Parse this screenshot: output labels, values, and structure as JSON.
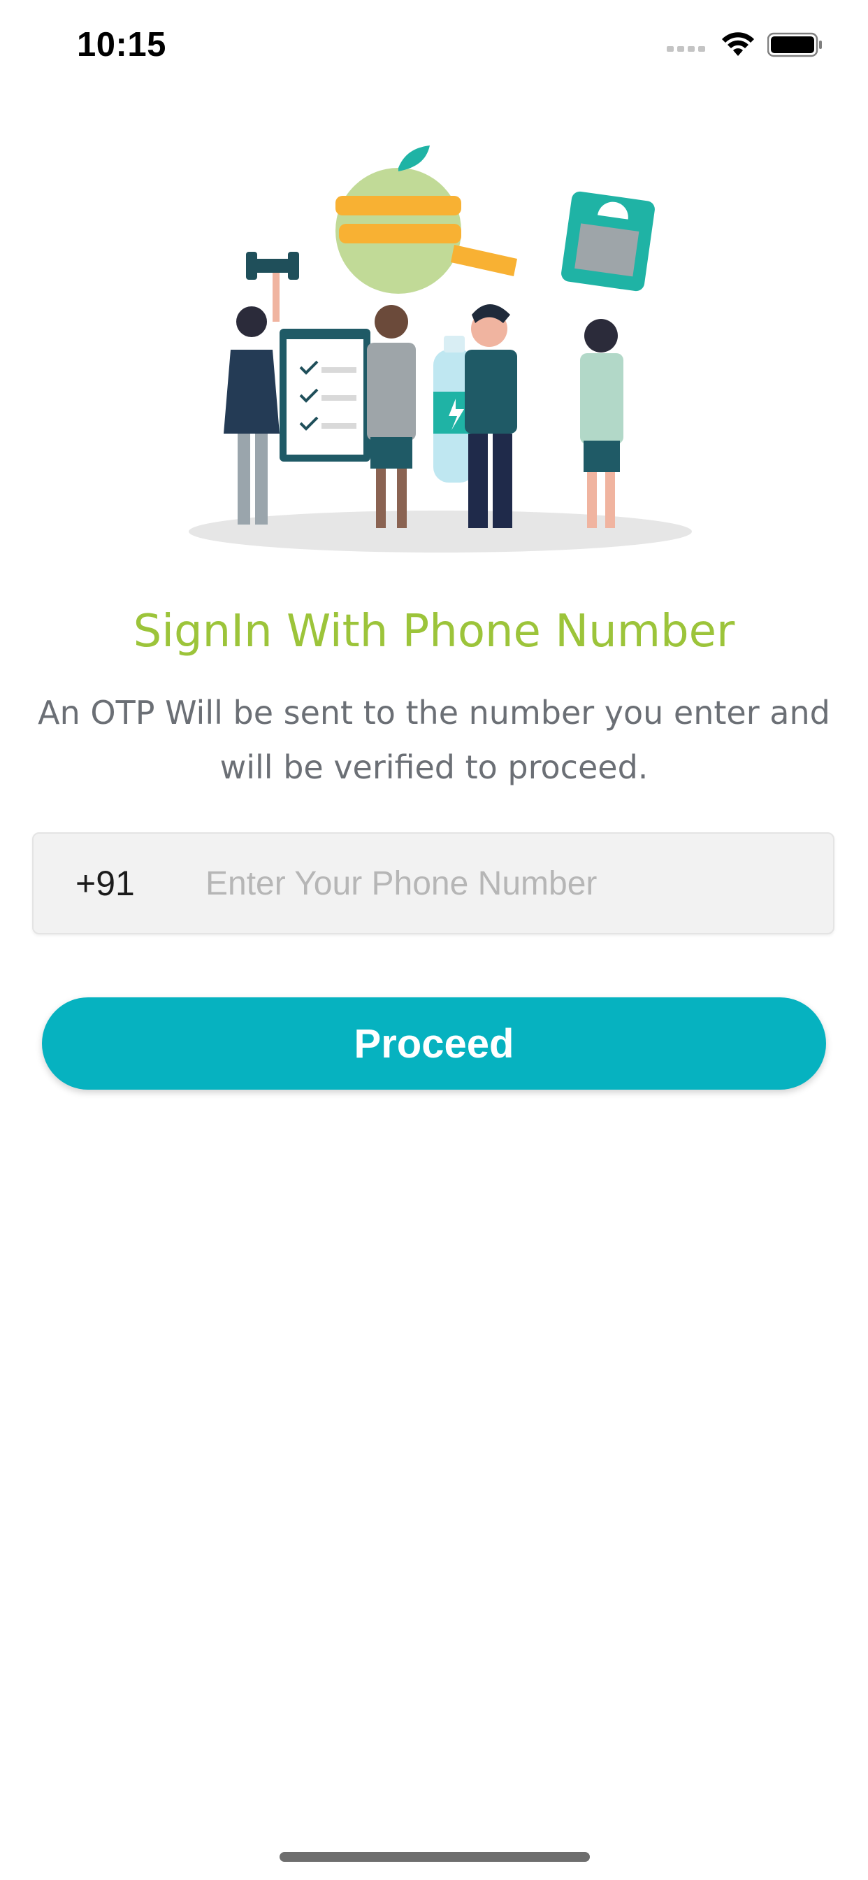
{
  "status_bar": {
    "time": "10:15"
  },
  "illustration": {
    "icon": "fitness-people-illustration"
  },
  "signin": {
    "title": "SignIn With Phone Number",
    "description": "An OTP Will be sent to the number you enter and will be verified to proceed."
  },
  "phone": {
    "country_code": "+91",
    "value": "",
    "placeholder": "Enter Your Phone Number"
  },
  "actions": {
    "proceed_label": "Proceed"
  },
  "colors": {
    "accent": "#06b2c0",
    "title_green": "#9cc43a",
    "subtitle_gray": "#6b6f75",
    "field_background": "#f2f2f2"
  }
}
